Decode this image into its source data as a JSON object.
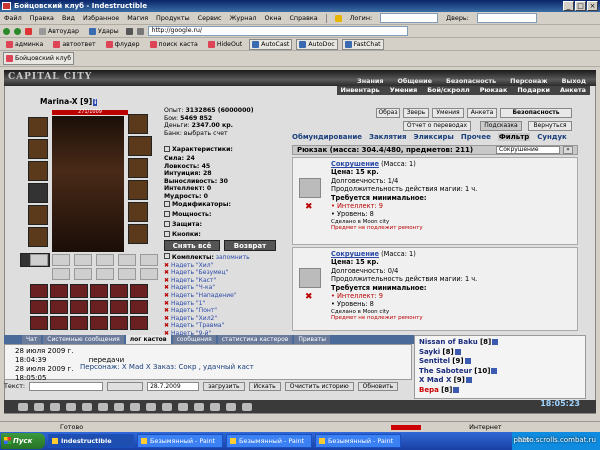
{
  "window": {
    "title": "Бойцовский клуб - Indestructible"
  },
  "menu": {
    "items": [
      "Файл",
      "Правка",
      "Вид",
      "Избранное",
      "Магия",
      "Продукты",
      "Сервис",
      "Журнал",
      "Окна",
      "Справка"
    ],
    "login_label": "Логин:",
    "door_label": "Дверь:"
  },
  "toolbar1": {
    "autocast": "Автоудар",
    "attacks": "Удары",
    "address": "http://google.ru/"
  },
  "toolbar2": {
    "links": [
      "админка",
      "автоответ",
      "флудер",
      "поиск каста",
      "HideOut",
      "AutoCast",
      "AutoDoc",
      "FastChat"
    ]
  },
  "tab_strip": {
    "label": "Бойцовский клуб"
  },
  "game": {
    "logo": "CAPITAL CITY",
    "nav_top": [
      "Знания",
      "Общение",
      "Безопасность",
      "Персонаж",
      "Выход"
    ],
    "nav_sub": [
      "Инвентарь",
      "Умения",
      "Бой/скролл",
      "Рюкзак",
      "Подарки",
      "Анкета"
    ],
    "char_name": "Marina-X",
    "char_level": "[9]",
    "hp": "271/1009",
    "stats_top": {
      "exp_label": "Опыт:",
      "exp_value": "3132865 (6000000)",
      "wins_label": "Бои:",
      "wins_value": "5469",
      "wins_extra": "852",
      "money_label": "Деньги:",
      "money_value": "2347.00 кр.",
      "bank_label": "Банк:",
      "bank_value": "выбрать счет"
    },
    "stats_header": "Характеристики:",
    "stats": [
      {
        "label": "Сила:",
        "value": "24"
      },
      {
        "label": "Ловкость:",
        "value": "45"
      },
      {
        "label": "Интуиция:",
        "value": "28"
      },
      {
        "label": "Выносливость:",
        "value": "30"
      },
      {
        "label": "Интеллект:",
        "value": "0"
      },
      {
        "label": "Мудрость:",
        "value": "0"
      }
    ],
    "sections": [
      "Модификаторы:",
      "Мощность:",
      "Защита:",
      "Кнопки:"
    ],
    "btn_remove_all": "Снять всё",
    "btn_return": "Возврат",
    "sets_header": "Комплекты:",
    "sets_remember": "запомнить",
    "sets": [
      "Надеть \"Хил\"",
      "Надеть \"Безумец\"",
      "Надеть \"Каст\"",
      "Надеть \"Ч-ка\"",
      "Надеть \"Нападение\"",
      "Надеть \"1\"",
      "Надеть \"Понт\"",
      "Надеть \"Хил2\"",
      "Надеть \"Травма\"",
      "Надеть \"9-й\""
    ],
    "right_buttons": [
      "Образ",
      "Зверь",
      "Умения",
      "Анкета",
      "Безопасность"
    ],
    "report_button": "Отчет о переводах",
    "hint_button": "Подсказка",
    "return_button": "Вернуться",
    "tabs": [
      "Обмундирование",
      "Заклятия",
      "Эликсиры",
      "Прочее",
      "Фильтр",
      "Сундук"
    ],
    "backpack_title": "Рюкзак (масса: 304.4/480, предметов: 211)",
    "backpack_search": "Сокрушение",
    "items": [
      {
        "name": "Сокрушение",
        "mass": "(Масса: 1)",
        "price": "Цена: 15 кр.",
        "durability": "Долговечность: 1/4",
        "duration": "Продолжительность действия магии: 1 ч.",
        "req_header": "Требуется минимальное:",
        "req_int": "• Интеллект: 9",
        "req_lvl": "• Уровень: 8",
        "made": "Сделано в Moon city",
        "warn": "Предмет не подлежит ремонту"
      },
      {
        "name": "Сокрушение",
        "mass": "(Масса: 1)",
        "price": "Цена: 15 кр.",
        "durability": "Долговечность: 0/4",
        "duration": "Продолжительность действия магии: 1 ч.",
        "req_header": "Требуется минимальное:",
        "req_int": "• Интеллект: 9",
        "req_lvl": "• Уровень: 8",
        "made": "Сделано в Moon city",
        "warn": "Предмет не подлежит ремонту"
      }
    ]
  },
  "chat": {
    "tabs": [
      "Чат",
      "Системные сообщения",
      "лог кастов",
      "сообщения",
      "статистика кастеров",
      "Приваты"
    ],
    "lines": [
      {
        "time": "28 июля 2009 г.",
        "text": ""
      },
      {
        "time": "18:04:39",
        "text": "передачи"
      },
      {
        "time": "28 июля 2009 г.",
        "text": ""
      },
      {
        "time": "18:05:05",
        "text": ""
      }
    ],
    "order_line": "Персонаж: X Mad X Заказ: Сокр , удачный каст",
    "input_label": "Текст:",
    "date_value": "28.7.2009",
    "buttons": [
      "загрузить",
      "Искать",
      "Очистить историю",
      "Обновить"
    ]
  },
  "players": [
    {
      "name": "Nissan of Baku",
      "level": "[8]",
      "red": false
    },
    {
      "name": "Sayki",
      "level": "[8]",
      "red": false
    },
    {
      "name": "Sentitel",
      "level": "[9]",
      "red": false
    },
    {
      "name": "The Saboteur",
      "level": "[10]",
      "red": false
    },
    {
      "name": "X Mad X",
      "level": "[9]",
      "red": false
    },
    {
      "name": "Вера",
      "level": "[8]",
      "red": true
    }
  ],
  "game_clock": "18:05:23",
  "status": {
    "text": "Готово",
    "zone": "Интернет"
  },
  "taskbar": {
    "start": "Пуск",
    "tasks": [
      "Indestructible",
      "Безымянный - Paint",
      "Безымянный - Paint",
      "Безымянный - Paint"
    ],
    "tray_time": "229"
  },
  "watermark": "photo.scrolls.combat.ru"
}
